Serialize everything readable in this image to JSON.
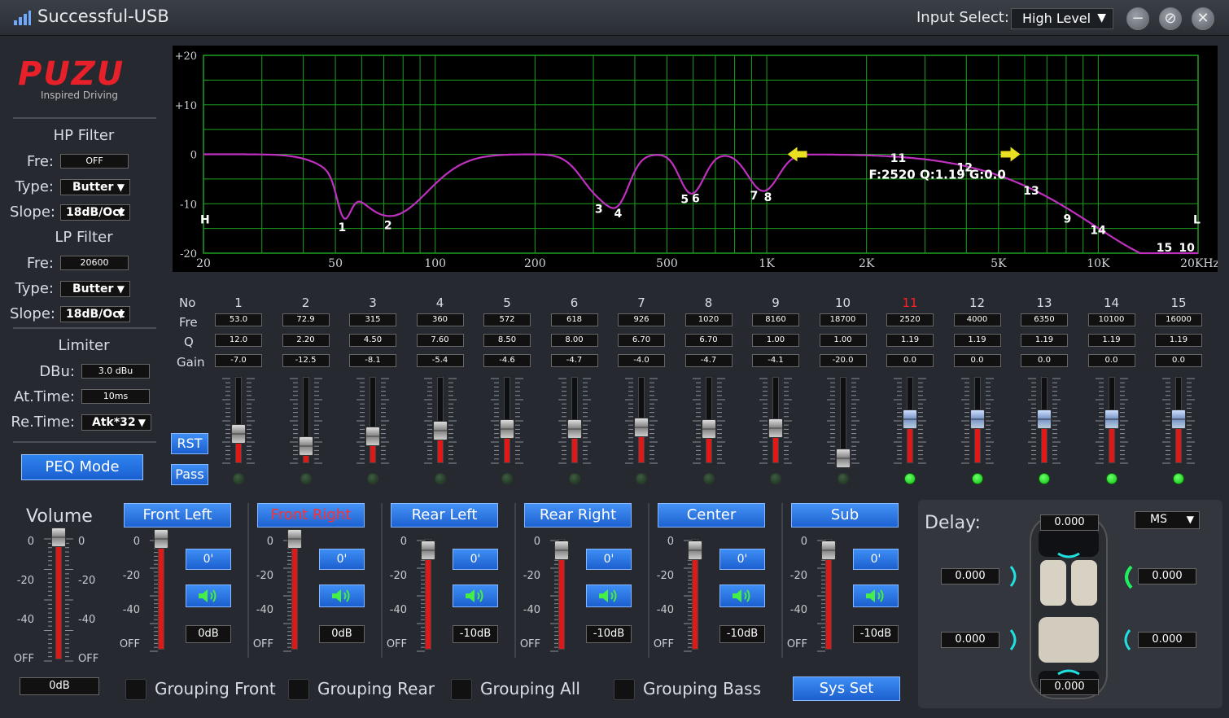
{
  "window": {
    "title": "Successful-USB",
    "input_select_label": "Input Select:",
    "input_select_value": "High Level"
  },
  "logo": {
    "brand": "PUZU",
    "tagline": "Inspired Driving"
  },
  "hp_filter": {
    "title": "HP Filter",
    "fre_label": "Fre:",
    "fre_value": "OFF",
    "type_label": "Type:",
    "type_value": "Butter",
    "slope_label": "Slope:",
    "slope_value": "18dB/Oct"
  },
  "lp_filter": {
    "title": "LP Filter",
    "fre_label": "Fre:",
    "fre_value": "20600",
    "type_label": "Type:",
    "type_value": "Butter",
    "slope_label": "Slope:",
    "slope_value": "18dB/Oct"
  },
  "limiter": {
    "title": "Limiter",
    "dbu_label": "DBu:",
    "dbu_value": "3.0 dBu",
    "attime_label": "At.Time:",
    "attime_value": "10ms",
    "retime_label": "Re.Time:",
    "retime_value": "Atk*32"
  },
  "peq_mode_label": "PEQ Mode",
  "graph": {
    "y_labels": [
      "+20",
      "+10",
      "0",
      "-10",
      "-20"
    ],
    "x_labels": [
      "20",
      "50",
      "100",
      "200",
      "500",
      "1K",
      "2K",
      "5K",
      "10K",
      "20KHz"
    ],
    "marker_h": "H",
    "marker_l": "L",
    "info": "F:2520 Q:1.19 G:0.0",
    "point_labels": [
      "1",
      "2",
      "3",
      "4",
      "5",
      "6",
      "7",
      "8",
      "9",
      "10",
      "11",
      "12",
      "13",
      "14",
      "15"
    ]
  },
  "eq": {
    "row_labels": {
      "no": "No",
      "fre": "Fre",
      "q": "Q",
      "gain": "Gain"
    },
    "active_band": 11,
    "bands": [
      {
        "no": "1",
        "fre": "53.0",
        "q": "12.0",
        "gain": "-7.0",
        "gain_db": -7.0,
        "led_on": false
      },
      {
        "no": "2",
        "fre": "72.9",
        "q": "2.20",
        "gain": "-12.5",
        "gain_db": -12.5,
        "led_on": false
      },
      {
        "no": "3",
        "fre": "315",
        "q": "4.50",
        "gain": "-8.1",
        "gain_db": -8.1,
        "led_on": false
      },
      {
        "no": "4",
        "fre": "360",
        "q": "7.60",
        "gain": "-5.4",
        "gain_db": -5.4,
        "led_on": false
      },
      {
        "no": "5",
        "fre": "572",
        "q": "8.50",
        "gain": "-4.6",
        "gain_db": -4.6,
        "led_on": false
      },
      {
        "no": "6",
        "fre": "618",
        "q": "8.00",
        "gain": "-4.7",
        "gain_db": -4.7,
        "led_on": false
      },
      {
        "no": "7",
        "fre": "926",
        "q": "6.70",
        "gain": "-4.0",
        "gain_db": -4.0,
        "led_on": false
      },
      {
        "no": "8",
        "fre": "1020",
        "q": "6.70",
        "gain": "-4.7",
        "gain_db": -4.7,
        "led_on": false
      },
      {
        "no": "9",
        "fre": "8160",
        "q": "1.00",
        "gain": "-4.1",
        "gain_db": -4.1,
        "led_on": false
      },
      {
        "no": "10",
        "fre": "18700",
        "q": "1.00",
        "gain": "-20.0",
        "gain_db": -20.0,
        "led_on": false
      },
      {
        "no": "11",
        "fre": "2520",
        "q": "1.19",
        "gain": "0.0",
        "gain_db": 0.0,
        "led_on": true
      },
      {
        "no": "12",
        "fre": "4000",
        "q": "1.19",
        "gain": "0.0",
        "gain_db": 0.0,
        "led_on": true
      },
      {
        "no": "13",
        "fre": "6350",
        "q": "1.19",
        "gain": "0.0",
        "gain_db": 0.0,
        "led_on": true
      },
      {
        "no": "14",
        "fre": "10100",
        "q": "1.19",
        "gain": "0.0",
        "gain_db": 0.0,
        "led_on": true
      },
      {
        "no": "15",
        "fre": "16000",
        "q": "1.19",
        "gain": "0.0",
        "gain_db": 0.0,
        "led_on": true
      }
    ],
    "rst_label": "RST",
    "pass_label": "Pass"
  },
  "volume": {
    "title": "Volume",
    "value": "0dB",
    "scale": [
      "0",
      "-20",
      "-40",
      "OFF"
    ]
  },
  "channels": [
    {
      "name": "Front Left",
      "phase": "0'",
      "level": "0dB",
      "active": false
    },
    {
      "name": "Front Right",
      "phase": "0'",
      "level": "0dB",
      "active": true
    },
    {
      "name": "Rear Left",
      "phase": "0'",
      "level": "-10dB",
      "active": false
    },
    {
      "name": "Rear Right",
      "phase": "0'",
      "level": "-10dB",
      "active": false
    },
    {
      "name": "Center",
      "phase": "0'",
      "level": "-10dB",
      "active": false
    },
    {
      "name": "Sub",
      "phase": "0'",
      "level": "-10dB",
      "active": false
    }
  ],
  "channel_scale": [
    "0",
    "-20",
    "-40",
    "OFF"
  ],
  "grouping": [
    "Grouping Front",
    "Grouping Rear",
    "Grouping All",
    "Grouping Bass"
  ],
  "sys_set_label": "Sys Set",
  "delay": {
    "title": "Delay:",
    "unit": "MS",
    "top": "0.000",
    "front_left": "0.000",
    "front_right": "0.000",
    "rear_left": "0.000",
    "rear_right": "0.000",
    "bottom": "0.000"
  },
  "colors": {
    "accent_blue": "#1c5fcf",
    "curve": "#c030c0",
    "grid": "#1fa01f",
    "slider_fill": "#e01818",
    "brand_red": "#e8202a"
  }
}
